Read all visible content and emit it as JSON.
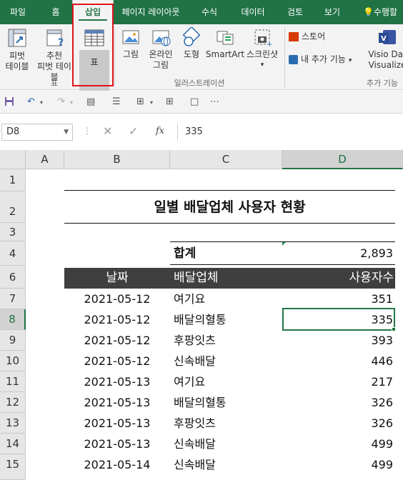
{
  "tabs": [
    "파일",
    "홈",
    "삽입",
    "페이지 레이아웃",
    "수식",
    "데이터",
    "검토",
    "보기",
    "수행할"
  ],
  "ribbon": {
    "pivot": [
      "피벗",
      "테이블"
    ],
    "recommended_pivot": [
      "추천",
      "피벗 테이블"
    ],
    "table": "표",
    "group_table": "표",
    "picture": "그림",
    "online_picture": [
      "온라인",
      "그림"
    ],
    "shapes": "도형",
    "smartart": "SmartArt",
    "screenshot": "스크린샷",
    "group_illustrations": "일러스트레이션",
    "store": "스토어",
    "my_addins": "내 추가 기능",
    "visio": [
      "Visio Dat",
      "Visualize"
    ],
    "group_addins": "추가 기능"
  },
  "formula_bar": {
    "name_box": "D8",
    "fx": "fx",
    "formula": "335"
  },
  "columns": [
    "A",
    "B",
    "C",
    "D"
  ],
  "rows": [
    "1",
    "2",
    "3",
    "4",
    "6",
    "7",
    "8",
    "9",
    "10",
    "11",
    "12",
    "13",
    "14",
    "15"
  ],
  "sheet": {
    "title": "일별 배달업체 사용자 현황",
    "total_label": "합계",
    "total_value": "2,893",
    "headers": [
      "날짜",
      "배달업체",
      "사용자수"
    ],
    "data": [
      [
        "2021-05-12",
        "여기요",
        "351"
      ],
      [
        "2021-05-12",
        "배달의혈통",
        "335"
      ],
      [
        "2021-05-12",
        "후팡잇츠",
        "393"
      ],
      [
        "2021-05-12",
        "신속배달",
        "446"
      ],
      [
        "2021-05-13",
        "여기요",
        "217"
      ],
      [
        "2021-05-13",
        "배달의혈통",
        "326"
      ],
      [
        "2021-05-13",
        "후팡잇츠",
        "326"
      ],
      [
        "2021-05-13",
        "신속배달",
        "499"
      ],
      [
        "2021-05-14",
        "신속배달",
        "499"
      ]
    ]
  },
  "colors": {
    "excel_green": "#217346",
    "header_band": "#3f3f3f",
    "highlight_red": "#e0141b"
  }
}
